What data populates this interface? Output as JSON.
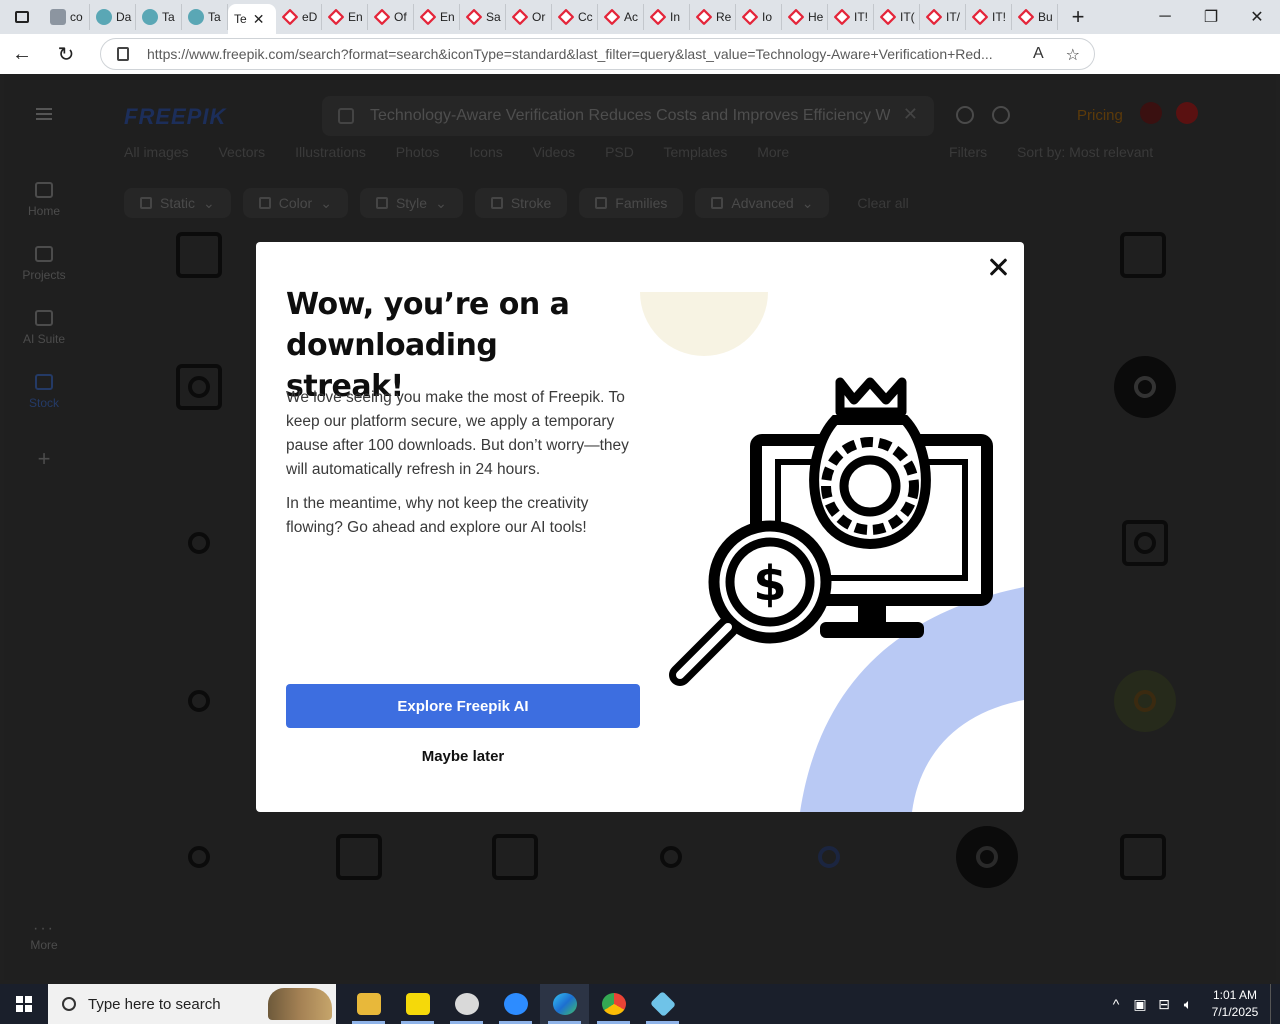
{
  "browser": {
    "tabs": [
      {
        "label": "co",
        "icon": "grey"
      },
      {
        "label": "Da",
        "icon": "teal"
      },
      {
        "label": "Ta",
        "icon": "teal"
      },
      {
        "label": "Ta",
        "icon": "teal"
      },
      {
        "label": "Te",
        "icon": "none",
        "active": true
      },
      {
        "label": "eD",
        "icon": "red"
      },
      {
        "label": "En",
        "icon": "red"
      },
      {
        "label": "Of",
        "icon": "red"
      },
      {
        "label": "En",
        "icon": "red"
      },
      {
        "label": "Sa",
        "icon": "red"
      },
      {
        "label": "Or",
        "icon": "red"
      },
      {
        "label": "Cc",
        "icon": "red"
      },
      {
        "label": "Ac",
        "icon": "red"
      },
      {
        "label": "In",
        "icon": "red"
      },
      {
        "label": "Re",
        "icon": "red"
      },
      {
        "label": "Io",
        "icon": "red"
      },
      {
        "label": "He",
        "icon": "red"
      },
      {
        "label": "IT!",
        "icon": "red"
      },
      {
        "label": "IT(",
        "icon": "red"
      },
      {
        "label": "IT/",
        "icon": "red"
      },
      {
        "label": "IT!",
        "icon": "red"
      },
      {
        "label": "Bu",
        "icon": "red"
      }
    ],
    "new_tab": "+",
    "url": "https://www.freepik.com/search?format=search&iconType=standard&last_filter=query&last_value=Technology-Aware+Verification+Red..."
  },
  "page": {
    "logo": "FREEPIK",
    "search_value": "Technology-Aware Verification Reduces Costs and Improves Efficiency W",
    "pricing": "Pricing",
    "subnav": [
      "All images",
      "Vectors",
      "Illustrations",
      "Photos",
      "Icons",
      "Videos",
      "PSD",
      "Templates",
      "More"
    ],
    "filters_label": "Filters",
    "sort_label": "Sort by: Most relevant",
    "sidebar": [
      {
        "label": "Home",
        "key": "home"
      },
      {
        "label": "Projects",
        "key": "projects"
      },
      {
        "label": "AI Suite",
        "key": "ai-suite"
      },
      {
        "label": "Stock",
        "key": "stock"
      }
    ],
    "sidebar_more": "More",
    "filter_chips": [
      "Static",
      "Color",
      "Style",
      "Stroke",
      "Families",
      "Advanced"
    ],
    "clear_all": "Clear all"
  },
  "modal": {
    "title": "Wow, you’re on a downloading streak!",
    "paragraph1": "We love seeing you make the most of Freepik. To keep our platform secure, we apply a temporary pause after 100 downloads. But don’t worry—they will automatically refresh in 24 hours.",
    "paragraph2": "In the meantime, why not keep the creativity flowing? Go ahead and explore our AI tools!",
    "primary_button": "Explore Freepik AI",
    "secondary_button": "Maybe later",
    "colors": {
      "primary": "#3d6ee0",
      "accent_blue": "#b9c9f4",
      "accent_cream": "#f7f3e3"
    }
  },
  "taskbar": {
    "search_placeholder": "Type here to search",
    "time": "1:01 AM",
    "date": "7/1/2025",
    "apps": [
      "file-explorer",
      "sticky-notes",
      "snipping-tool",
      "zoom",
      "edge",
      "chrome",
      "app"
    ]
  }
}
